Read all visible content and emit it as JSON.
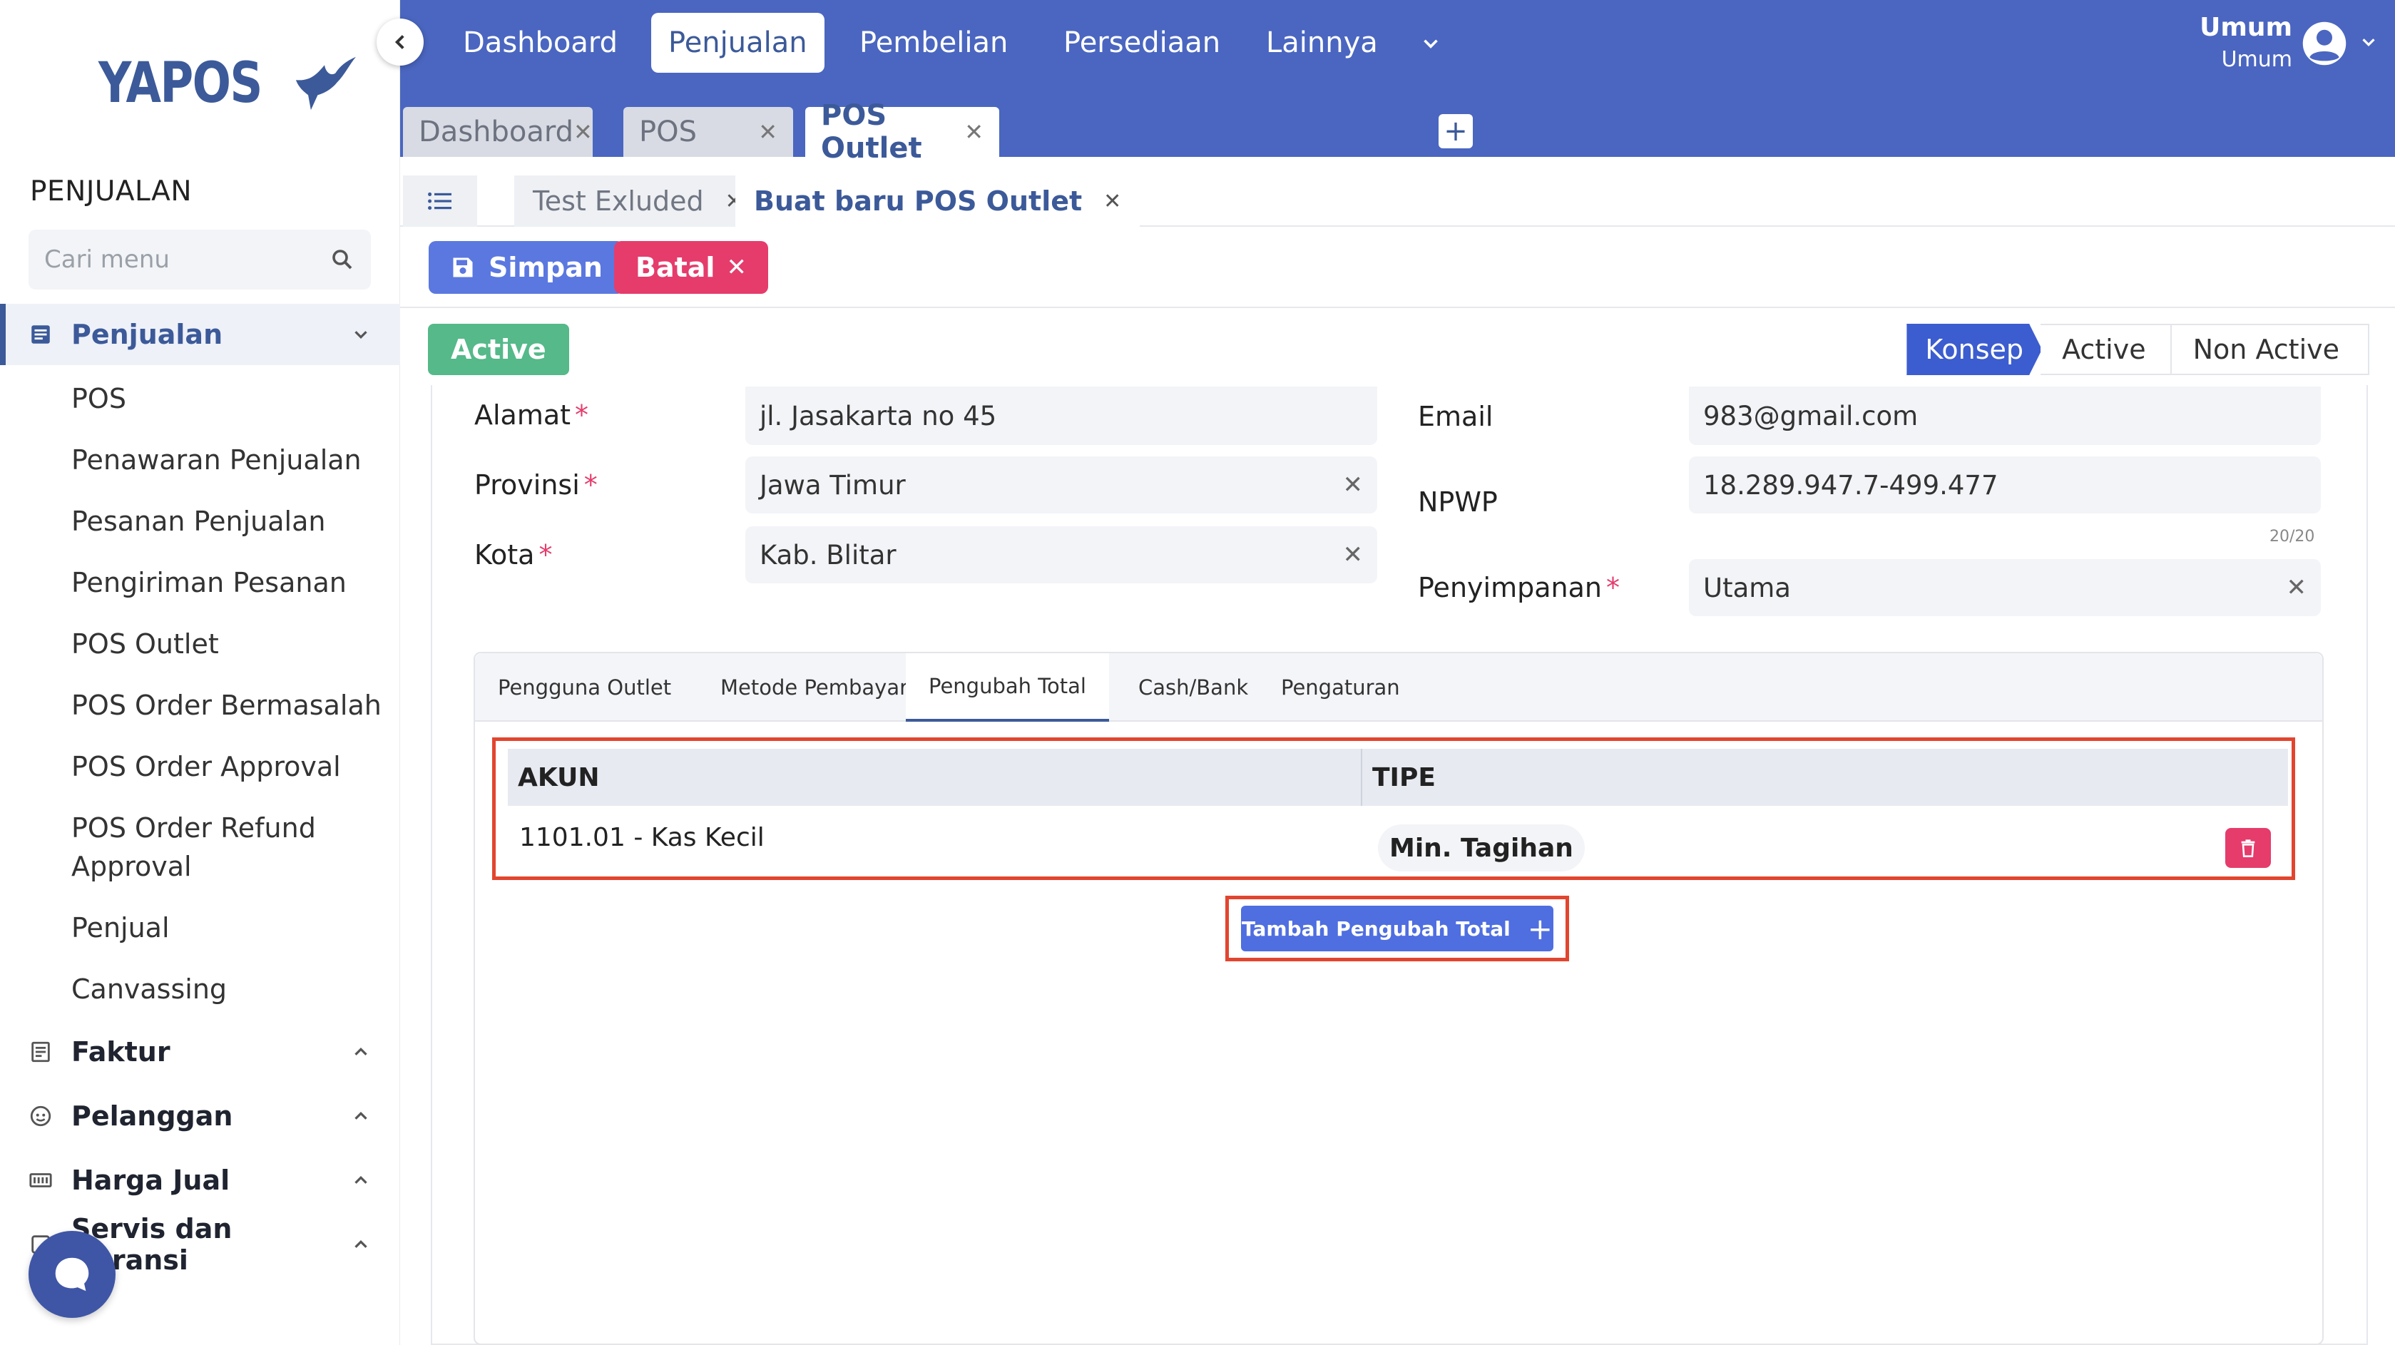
{
  "app": {
    "logo": "YAPOS"
  },
  "sidebar": {
    "section_title": "PENJUALAN",
    "search_placeholder": "Cari menu",
    "groups": [
      {
        "label": "Penjualan",
        "icon": "document-list-icon",
        "expanded": true
      },
      {
        "label": "Faktur",
        "icon": "receipt-icon",
        "expanded": false
      },
      {
        "label": "Pelanggan",
        "icon": "face-icon",
        "expanded": false
      },
      {
        "label": "Harga Jual",
        "icon": "price-tag-icon",
        "expanded": false
      },
      {
        "label": "Servis dan Garansi",
        "icon": "tool-icon",
        "expanded": false
      }
    ],
    "items": [
      "POS",
      "Penawaran Penjualan",
      "Pesanan Penjualan",
      "Pengiriman Pesanan",
      "POS Outlet",
      "POS Order Bermasalah",
      "POS Order Approval",
      "POS Order Refund Approval",
      "Penjual",
      "Canvassing"
    ]
  },
  "topnav": {
    "items": [
      "Dashboard",
      "Penjualan",
      "Pembelian",
      "Persediaan",
      "Lainnya"
    ],
    "active": "Penjualan",
    "user_name": "Umum",
    "user_role": "Umum"
  },
  "doc_tabs": [
    {
      "label": "Dashboard",
      "active": false
    },
    {
      "label": "POS",
      "active": false
    },
    {
      "label": "POS Outlet",
      "active": true
    }
  ],
  "sub_tabs": [
    {
      "label": "Test Exluded",
      "active": false
    },
    {
      "label": "Buat baru POS Outlet",
      "active": true
    }
  ],
  "toolbar": {
    "save_label": "Simpan",
    "cancel_label": "Batal"
  },
  "status": {
    "badge": "Active",
    "steps": [
      "Konsep",
      "Active",
      "Non Active"
    ],
    "current_step": "Konsep"
  },
  "form": {
    "alamat": {
      "label": "Alamat",
      "value": "jl. Jasakarta no 45"
    },
    "provinsi": {
      "label": "Provinsi",
      "value": "Jawa Timur"
    },
    "kota": {
      "label": "Kota",
      "value": "Kab. Blitar"
    },
    "email": {
      "label": "Email",
      "value": "983@gmail.com"
    },
    "npwp": {
      "label": "NPWP",
      "value": "18.289.947.7-499.477",
      "counter": "20/20"
    },
    "penyimpanan": {
      "label": "Penyimpanan",
      "value": "Utama"
    }
  },
  "inner_tabs": {
    "items": [
      "Pengguna Outlet",
      "Metode Pembayaran",
      "Pengubah Total",
      "Cash/Bank",
      "Pengaturan"
    ],
    "active": "Pengubah Total"
  },
  "table": {
    "columns": [
      "AKUN",
      "TIPE"
    ],
    "rows": [
      {
        "akun": "1101.01 - Kas Kecil",
        "tipe": "Min. Tagihan"
      }
    ],
    "add_button": "Tambah Pengubah Total"
  },
  "colors": {
    "primary": "#4a66c0",
    "brand": "#3c5a99",
    "success": "#55b98a",
    "danger": "#e53c6c",
    "highlight": "#e2452f"
  }
}
